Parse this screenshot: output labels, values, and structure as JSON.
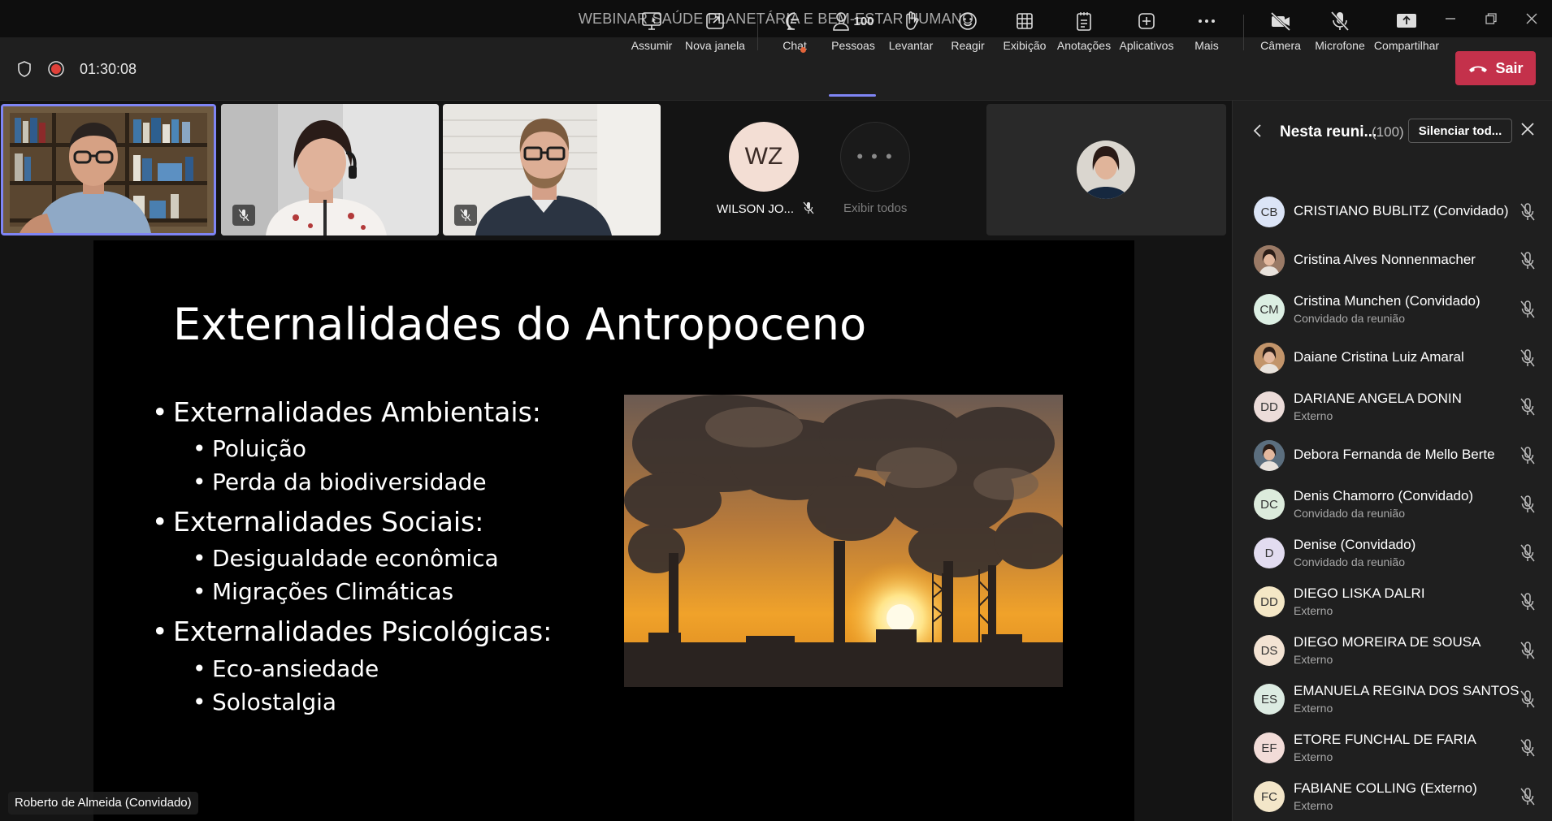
{
  "window": {
    "title": "WEBINAR SAÚDE PLANETÁRIA E BEM-ESTAR HUMANO"
  },
  "toolbar": {
    "timer": "01:30:08",
    "buttons": {
      "assumir": "Assumir",
      "nova_janela": "Nova janela",
      "chat": "Chat",
      "pessoas": "Pessoas",
      "pessoas_count": "100",
      "levantar": "Levantar",
      "reagir": "Reagir",
      "exibicao": "Exibição",
      "anotacoes": "Anotações",
      "aplicativos": "Aplicativos",
      "mais": "Mais",
      "camera": "Câmera",
      "microfone": "Microfone",
      "compartilhar": "Compartilhar",
      "sair": "Sair"
    },
    "colors": {
      "leave": "#c4314b",
      "accent": "#7f85f5"
    }
  },
  "strip": {
    "wz_initials": "WZ",
    "wz_name": "WILSON JO...",
    "show_all": "Exibir todos"
  },
  "slide": {
    "title": "Externalidades do Antropoceno",
    "bullets": [
      {
        "text": "Externalidades Ambientais:",
        "subs": [
          "Poluição",
          "Perda da biodiversidade"
        ]
      },
      {
        "text": "Externalidades Sociais:",
        "subs": [
          "Desigualdade econômica",
          "Migrações Climáticas"
        ]
      },
      {
        "text": "Externalidades Psicológicas:",
        "subs": [
          "Eco-ansiedade",
          "Solostalgia"
        ]
      }
    ]
  },
  "presenter": {
    "name": "Roberto de Almeida (Convidado)"
  },
  "panel": {
    "title": "Nesta reuni...",
    "count": "(100)",
    "mute_all": "Silenciar tod...",
    "participants": [
      {
        "initials": "CB",
        "name": "CRISTIANO BUBLITZ (Convidado)",
        "sub": "",
        "bg": "#dbe4f6"
      },
      {
        "initials": "",
        "name": "Cristina Alves Nonnenmacher",
        "sub": "",
        "bg": "#9a7a66"
      },
      {
        "initials": "CM",
        "name": "Cristina Munchen (Convidado)",
        "sub": "Convidado da reunião",
        "bg": "#dcefe3"
      },
      {
        "initials": "",
        "name": "Daiane Cristina Luiz Amaral",
        "sub": "",
        "bg": "#c2946a"
      },
      {
        "initials": "DD",
        "name": "DARIANE ANGELA DONIN",
        "sub": "Externo",
        "bg": "#ecdcd9"
      },
      {
        "initials": "",
        "name": "Debora Fernanda de Mello Berte",
        "sub": "",
        "bg": "#5b6e7e"
      },
      {
        "initials": "DC",
        "name": "Denis Chamorro (Convidado)",
        "sub": "Convidado da reunião",
        "bg": "#dcebdc"
      },
      {
        "initials": "D",
        "name": "Denise (Convidado)",
        "sub": "Convidado da reunião",
        "bg": "#e2dcf0"
      },
      {
        "initials": "DD",
        "name": "DIEGO LISKA DALRI",
        "sub": "Externo",
        "bg": "#f4e7c6"
      },
      {
        "initials": "DS",
        "name": "DIEGO MOREIRA DE SOUSA",
        "sub": "Externo",
        "bg": "#f3e3d3"
      },
      {
        "initials": "ES",
        "name": "EMANUELA REGINA DOS SANTOS",
        "sub": "Externo",
        "bg": "#dcebe2"
      },
      {
        "initials": "EF",
        "name": "ETORE FUNCHAL DE FARIA",
        "sub": "Externo",
        "bg": "#f2dcd8"
      },
      {
        "initials": "FC",
        "name": "FABIANE COLLING (Externo)",
        "sub": "Externo",
        "bg": "#f3e6c9"
      }
    ]
  }
}
